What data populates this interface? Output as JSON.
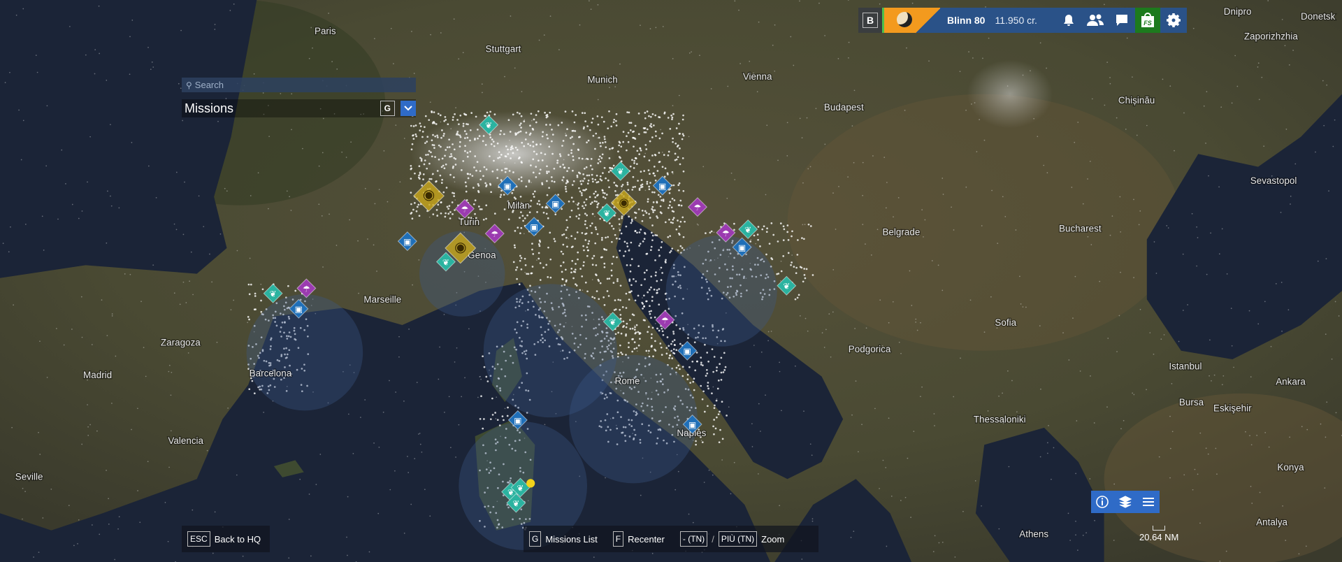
{
  "topbar": {
    "key_hint": "B",
    "player_name": "Blinn 80",
    "credits": "11.950 cr.",
    "icons": [
      "bell-icon",
      "friends-icon",
      "chat-icon",
      "fs-shop-icon",
      "gear-icon"
    ],
    "shop_label": "FS",
    "colors": {
      "bar": "#2a5288",
      "shop": "#1d7a1d",
      "status": "#4cc04c"
    }
  },
  "search": {
    "placeholder": "Search"
  },
  "missions_panel": {
    "title": "Missions",
    "key_hint": "G"
  },
  "footer": {
    "back": {
      "key": "ESC",
      "label": "Back to HQ"
    },
    "missions_list": {
      "key": "G",
      "label": "Missions List"
    },
    "recenter": {
      "key": "F",
      "label": "Recenter"
    },
    "zoom_out_key": "- (TN)",
    "separator": "/",
    "zoom_in_key": "PIÙ (TN)",
    "zoom_label": "Zoom"
  },
  "map_controls": {
    "icons": [
      "info-icon",
      "layers-icon",
      "list-icon"
    ],
    "scale": "20.64 NM"
  },
  "cities": [
    "Paris",
    "Stuttgart",
    "Munich",
    "Vienna",
    "Budapest",
    "Chișinău",
    "Dnipro",
    "Donetsk",
    "Zaporizhzhia",
    "Sevastopol",
    "Belgrade",
    "Bucharest",
    "Milan",
    "Turin",
    "Genoa",
    "Marseille",
    "Zaragoza",
    "Barcelona",
    "Madrid",
    "Valencia",
    "Seville",
    "Rome",
    "Naples",
    "Sofia",
    "Podgorica",
    "Istanbul",
    "Bursa",
    "Eskişehir",
    "Ankara",
    "Thessaloniki",
    "Konya",
    "Athens",
    "Antalya"
  ],
  "mission_colors": {
    "crop": "#2bb3a0",
    "parachute": "#9b3bb0",
    "cargo": "#1f6fb8",
    "photo": "#c9a81c"
  }
}
